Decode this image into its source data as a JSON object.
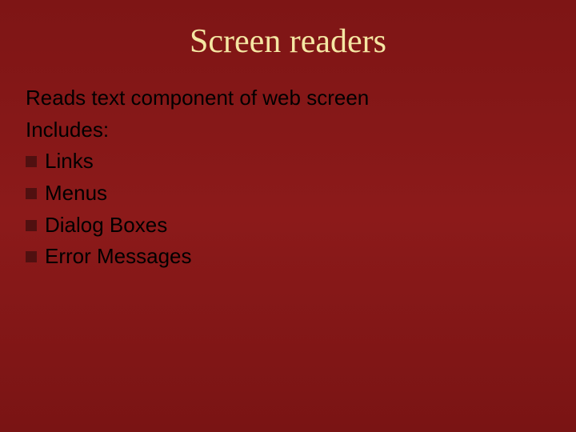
{
  "slide": {
    "title": "Screen readers",
    "intro": "Reads text component of web screen",
    "includes_label": "Includes:",
    "bullets": [
      "Links",
      "Menus",
      "Dialog Boxes",
      "Error Messages"
    ]
  }
}
